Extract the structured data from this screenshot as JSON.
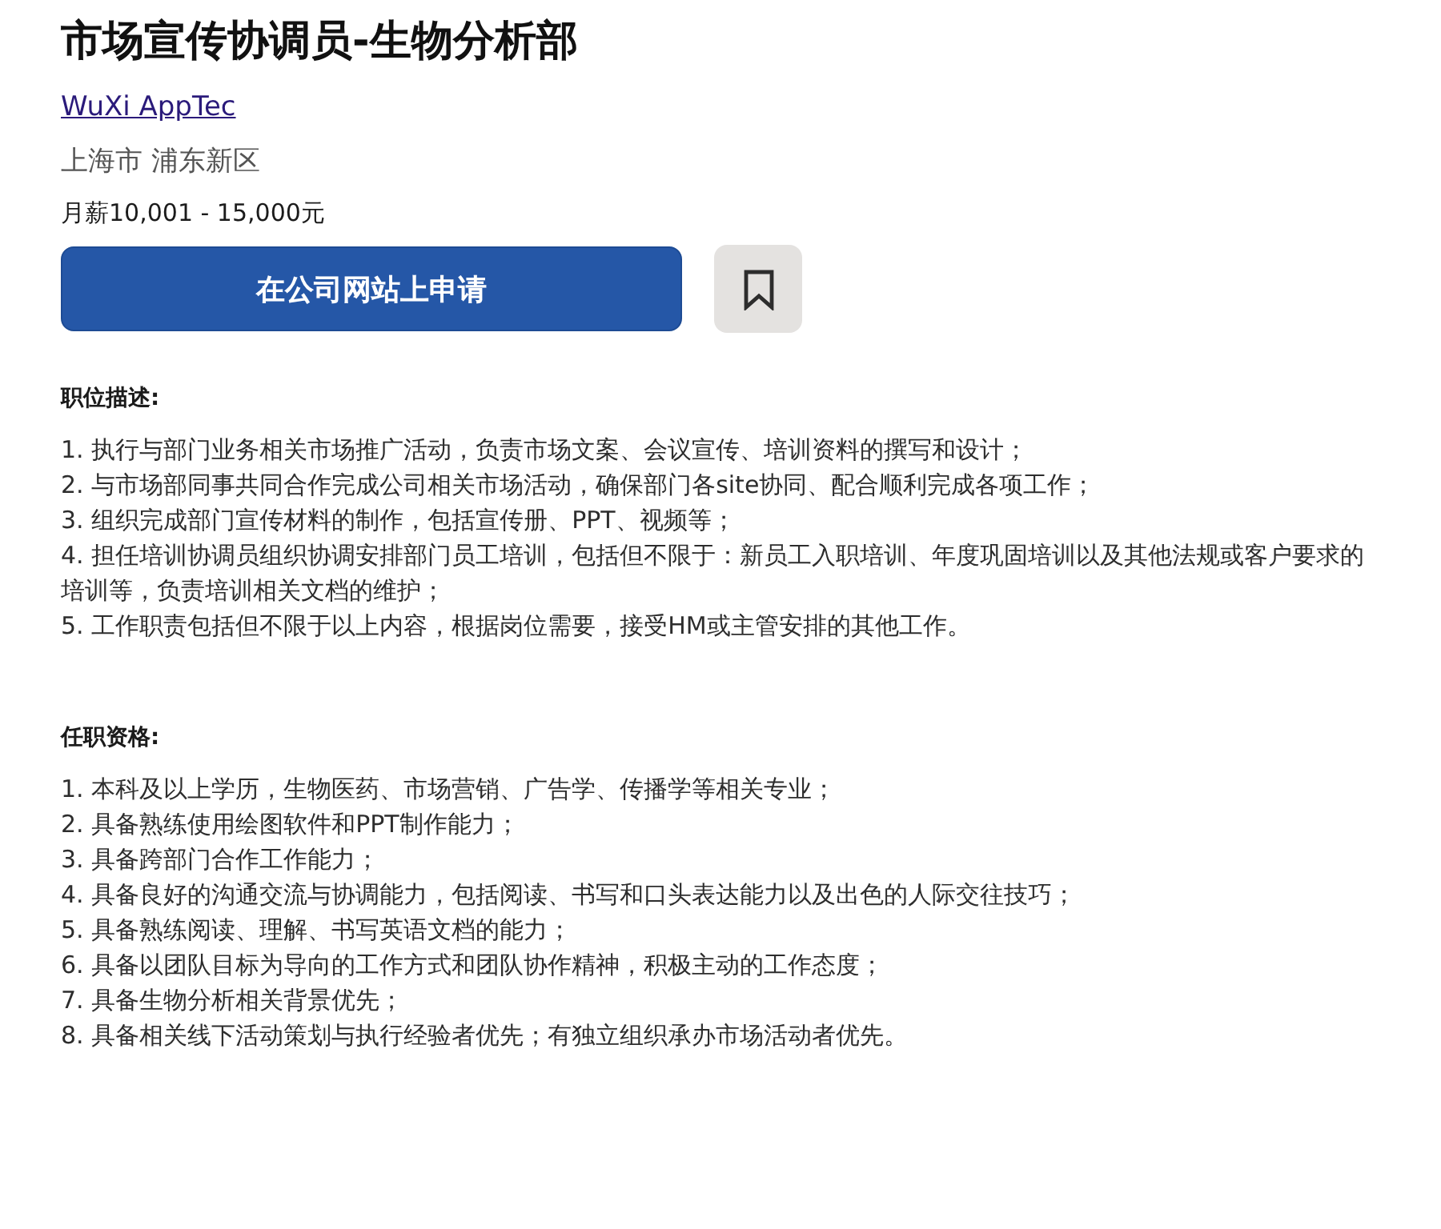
{
  "job": {
    "title": "市场宣传协调员-生物分析部",
    "company": "WuXi AppTec",
    "location": "上海市 浦东新区",
    "salary": "月薪10,001 - 15,000元"
  },
  "actions": {
    "apply_button": "在公司网站上申请",
    "saved": false
  },
  "sections": [
    {
      "heading": "职位描述:",
      "items": [
        "1. 执行与部门业务相关市场推广活动，负责市场文案、会议宣传、培训资料的撰写和设计；",
        "2. 与市场部同事共同合作完成公司相关市场活动，确保部门各site协同、配合顺利完成各项工作；",
        "3. 组织完成部门宣传材料的制作，包括宣传册、PPT、视频等；",
        "4. 担任培训协调员组织协调安排部门员工培训，包括但不限于：新员工入职培训、年度巩固培训以及其他法规或客户要求的培训等，负责培训相关文档的维护；",
        "5. 工作职责包括但不限于以上内容，根据岗位需要，接受HM或主管安排的其他工作。"
      ]
    },
    {
      "heading": "任职资格:",
      "items": [
        "1. 本科及以上学历，生物医药、市场营销、广告学、传播学等相关专业；",
        "2. 具备熟练使用绘图软件和PPT制作能力；",
        "3. 具备跨部门合作工作能力；",
        "4. 具备良好的沟通交流与协调能力，包括阅读、书写和口头表达能力以及出色的人际交往技巧；",
        "5. 具备熟练阅读、理解、书写英语文档的能力；",
        "6. 具备以团队目标为导向的工作方式和团队协作精神，积极主动的工作态度；",
        "7. 具备生物分析相关背景优先；",
        "8. 具备相关线下活动策划与执行经验者优先；有独立组织承办市场活动者优先。"
      ]
    }
  ]
}
